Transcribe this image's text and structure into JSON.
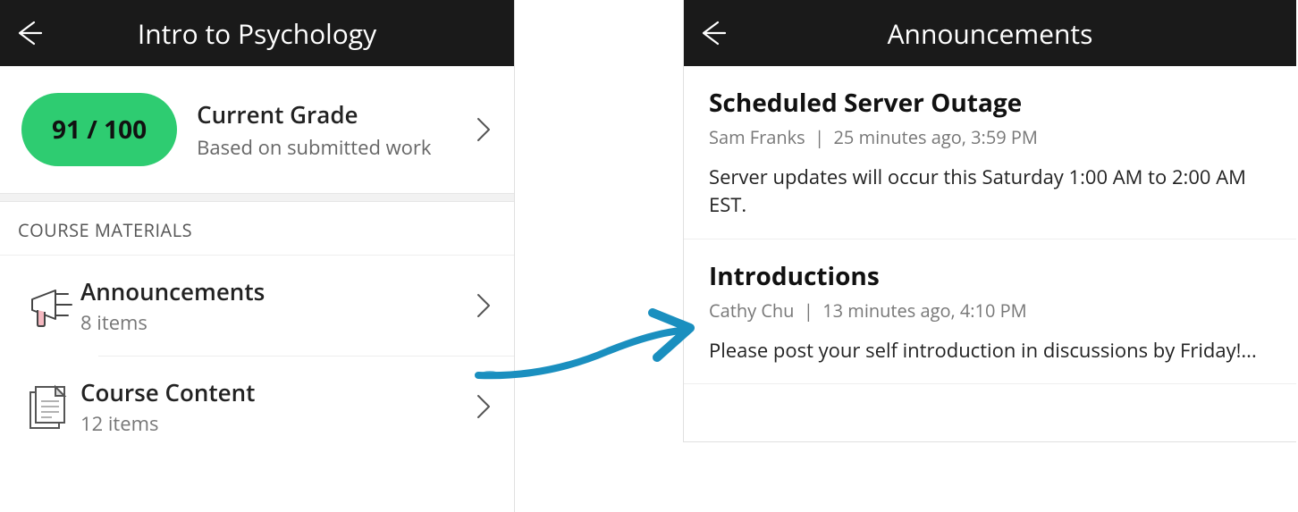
{
  "left": {
    "title": "Intro to Psychology",
    "grade": {
      "pill": "91 / 100",
      "label": "Current Grade",
      "sub": "Based on submitted work"
    },
    "section_label": "COURSE MATERIALS",
    "materials": [
      {
        "title": "Announcements",
        "sub": "8 items"
      },
      {
        "title": "Course Content",
        "sub": "12 items"
      }
    ]
  },
  "right": {
    "title": "Announcements",
    "items": [
      {
        "title": "Scheduled Server Outage",
        "author": "Sam Franks",
        "time": "25 minutes ago, 3:59 PM",
        "body": "Server updates will occur this Saturday 1:00 AM to 2:00 AM EST."
      },
      {
        "title": "Introductions",
        "author": "Cathy Chu",
        "time": "13 minutes ago, 4:10 PM",
        "body": "Please post your self introduction in discussions by Friday!..."
      }
    ]
  }
}
